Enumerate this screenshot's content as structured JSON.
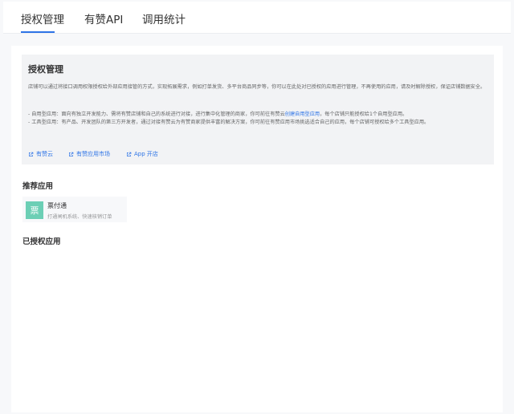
{
  "tabs": [
    {
      "label": "授权管理",
      "active": true
    },
    {
      "label": "有赞API",
      "active": false
    },
    {
      "label": "调用统计",
      "active": false
    }
  ],
  "info": {
    "title": "授权管理",
    "paragraph1": "店铺可以通过将接口调用权限授权给外部应用接管的方式，实现拓展需求，例如打单发货、多平台商品同步等，你可以在此处对已授权的应用进行管理，不再使用的应用，请及时解除授权，保证店铺数据安全。",
    "line2_prefix": "- 自用型应用：面向有独立开发能力、需将有赞店铺和自己的系统进行对接，进行集中化管理的商家，你可前往有赞云",
    "line2_link": "创建自用型应用",
    "line2_suffix": "，每个店铺只能授权给1个自用型应用。",
    "line3": "- 工具型应用：有产品、开发团队的第三方开发者，通过对接有赞云为有赞商家提供丰富的解决方案，你可前往有赞应用市场挑选适合自己的应用，每个店铺可授权给多个工具型应用。",
    "links": [
      "有赞云",
      "有赞应用市场",
      "App 开店"
    ]
  },
  "recommended": {
    "title": "推荐应用",
    "apps": [
      {
        "icon_char": "票",
        "name": "票付通",
        "desc": "打通闸机系统、快速核销订单"
      }
    ]
  },
  "authorized": {
    "title": "已授权应用"
  },
  "colors": {
    "accent": "#2e74e6",
    "app_icon_bg": "#6ccfb5"
  }
}
